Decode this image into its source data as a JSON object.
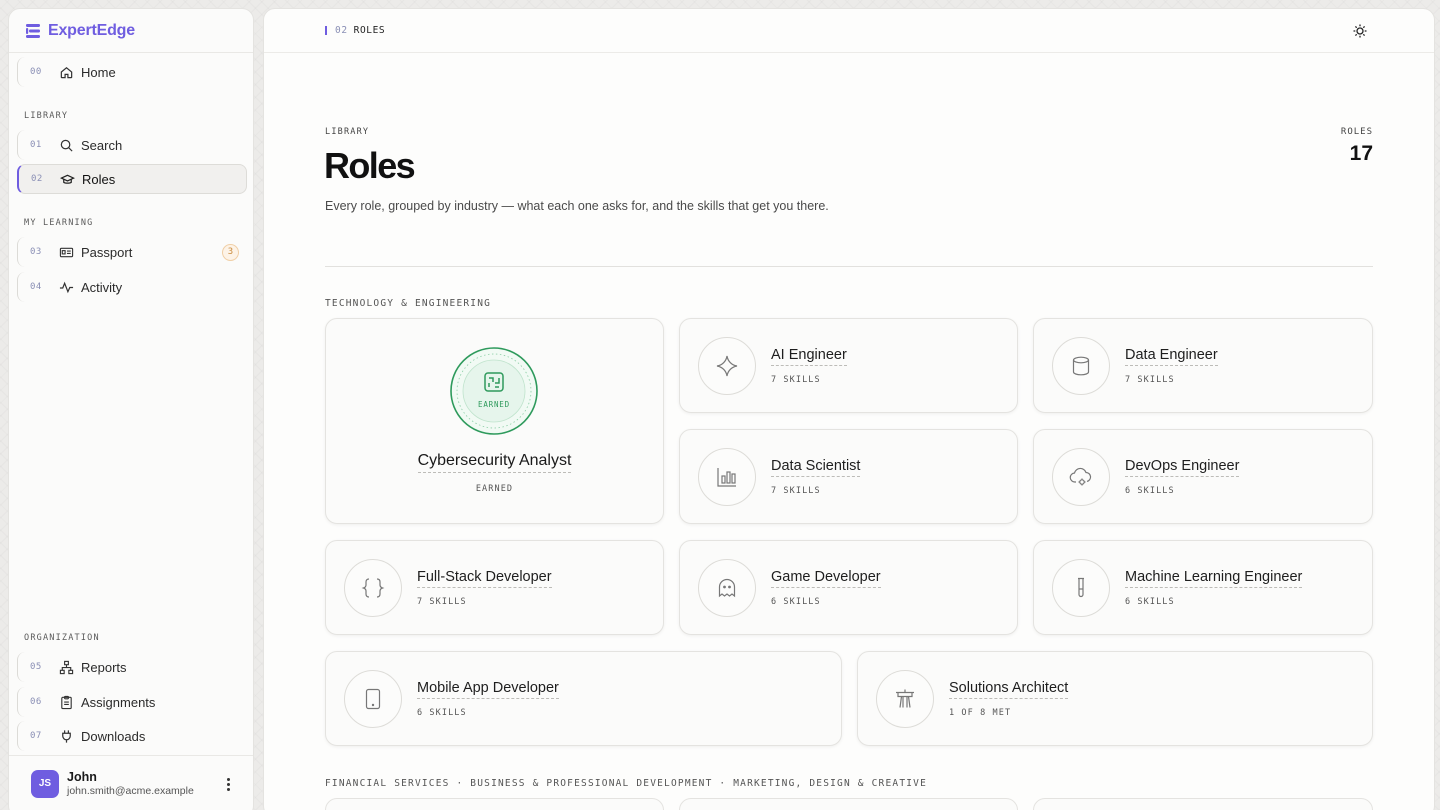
{
  "app": {
    "name": "ExpertEdge"
  },
  "sidebar": {
    "home": {
      "num": "00",
      "label": "Home"
    },
    "sections": {
      "library": "LIBRARY",
      "my_learning": "MY LEARNING",
      "organization": "ORGANIZATION"
    },
    "items": [
      {
        "num": "01",
        "label": "Search"
      },
      {
        "num": "02",
        "label": "Roles"
      },
      {
        "num": "03",
        "label": "Passport",
        "badge": "3"
      },
      {
        "num": "04",
        "label": "Activity"
      },
      {
        "num": "05",
        "label": "Reports"
      },
      {
        "num": "06",
        "label": "Assignments"
      },
      {
        "num": "07",
        "label": "Downloads"
      }
    ],
    "user": {
      "initials": "JS",
      "name": "John",
      "email": "john.smith@acme.example"
    }
  },
  "topbar": {
    "crumb_num": "02",
    "crumb_label": "ROLES"
  },
  "page": {
    "eyebrow": "LIBRARY",
    "title": "Roles",
    "subtitle": "Every role, grouped by industry — what each one asks for, and the skills that get you there.",
    "count_label": "ROLES",
    "count_value": "17"
  },
  "groups": {
    "tech": "TECHNOLOGY & ENGINEERING",
    "more": "FINANCIAL SERVICES · BUSINESS & PROFESSIONAL DEVELOPMENT · MARKETING, DESIGN & CREATIVE"
  },
  "featured": {
    "name": "Cybersecurity Analyst",
    "status": "EARNED",
    "seal_label": "EARNED"
  },
  "roles": [
    {
      "name": "AI Engineer",
      "meta": "7 SKILLS",
      "icon": "sparkle-icon"
    },
    {
      "name": "Data Engineer",
      "meta": "7 SKILLS",
      "icon": "database-icon"
    },
    {
      "name": "Data Scientist",
      "meta": "7 SKILLS",
      "icon": "bar-chart-icon"
    },
    {
      "name": "DevOps Engineer",
      "meta": "6 SKILLS",
      "icon": "cloud-gear-icon"
    },
    {
      "name": "Full-Stack Developer",
      "meta": "7 SKILLS",
      "icon": "braces-icon"
    },
    {
      "name": "Game Developer",
      "meta": "6 SKILLS",
      "icon": "ghost-icon"
    },
    {
      "name": "Machine Learning Engineer",
      "meta": "6 SKILLS",
      "icon": "test-tube-icon"
    },
    {
      "name": "Mobile App Developer",
      "meta": "6 SKILLS",
      "icon": "tablet-icon"
    },
    {
      "name": "Solutions Architect",
      "meta": "1 OF 8 MET",
      "icon": "tower-icon"
    }
  ]
}
